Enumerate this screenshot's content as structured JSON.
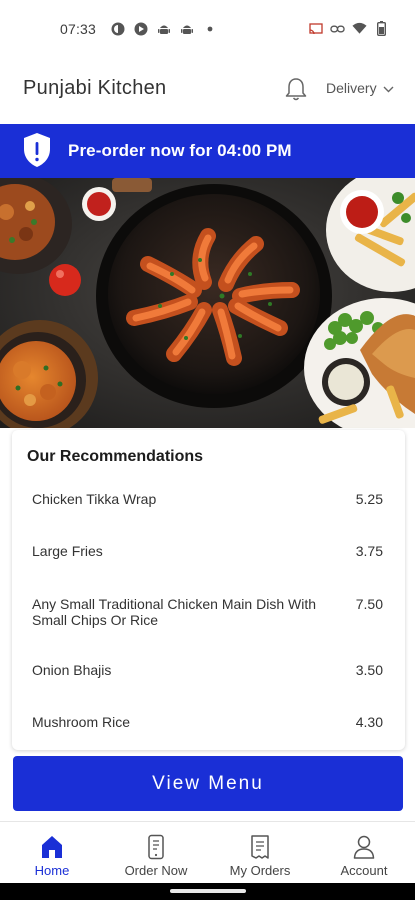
{
  "status_bar": {
    "time": "07:33",
    "left_icons": [
      "app-notification-icon",
      "app-notification-icon-2",
      "android-icon",
      "android-icon-2",
      "dot-icon"
    ],
    "right_icons": [
      "cast-icon",
      "link-icon",
      "wifi-icon",
      "battery-icon"
    ]
  },
  "header": {
    "title": "Punjabi Kitchen",
    "order_type": "Delivery"
  },
  "banner": {
    "text": "Pre-order now for 04:00 PM"
  },
  "recommendations": {
    "title": "Our Recommendations",
    "items": [
      {
        "name": "Chicken Tikka Wrap",
        "price": "5.25"
      },
      {
        "name": "Large Fries",
        "price": "3.75"
      },
      {
        "name": "Any Small Traditional Chicken Main Dish With Small Chips Or Rice",
        "price": "7.50"
      },
      {
        "name": "Onion Bhajis",
        "price": "3.50"
      },
      {
        "name": "Mushroom Rice",
        "price": "4.30"
      }
    ]
  },
  "cta": {
    "view_menu": "View Menu"
  },
  "nav": {
    "items": [
      {
        "label": "Home",
        "icon": "home-icon",
        "active": true
      },
      {
        "label": "Order Now",
        "icon": "phone-order-icon",
        "active": false
      },
      {
        "label": "My Orders",
        "icon": "receipt-icon",
        "active": false
      },
      {
        "label": "Account",
        "icon": "person-icon",
        "active": false
      }
    ]
  },
  "colors": {
    "brand": "#1a2fd6",
    "active_nav": "#1a2fd6"
  }
}
